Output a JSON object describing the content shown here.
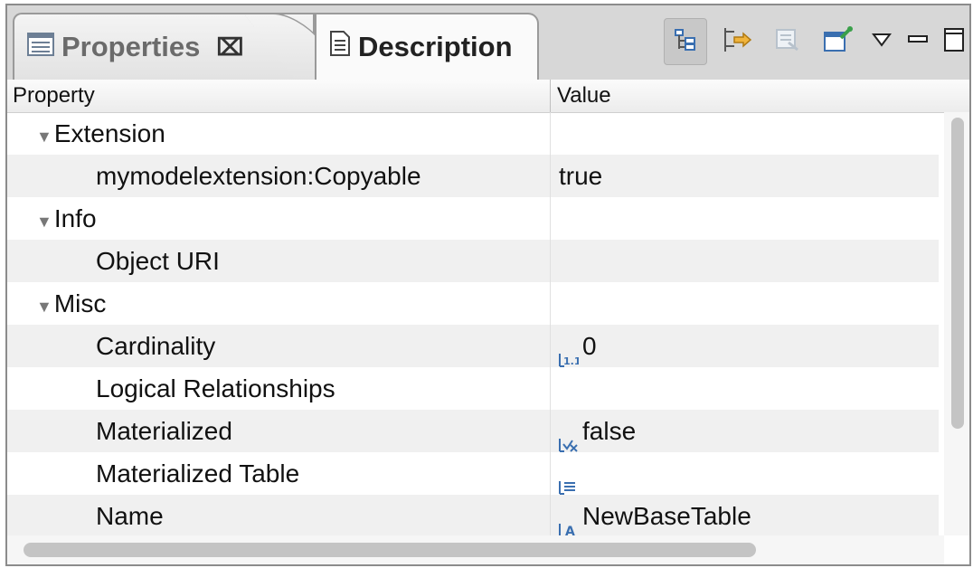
{
  "tabs": [
    {
      "label": "Properties",
      "close": "⌧",
      "icon": "properties-icon"
    },
    {
      "label": "Description",
      "icon": "document-icon"
    }
  ],
  "toolbar": {
    "buttons": [
      "categories-icon",
      "advanced-filter-icon",
      "restore-default-icon",
      "pin-icon"
    ],
    "view_menu": "view-menu-icon",
    "minimize": "minimize-icon",
    "maximize": "maximize-icon"
  },
  "header": {
    "property": "Property",
    "value": "Value"
  },
  "rows": [
    {
      "property": "Extension",
      "value": "",
      "type": "category",
      "expanded": true
    },
    {
      "property": "mymodelextension:Copyable",
      "value": "true",
      "type": "item"
    },
    {
      "property": "Info",
      "value": "",
      "type": "category",
      "expanded": true
    },
    {
      "property": "Object URI",
      "value": "",
      "type": "item"
    },
    {
      "property": "Misc",
      "value": "",
      "type": "category",
      "expanded": true
    },
    {
      "property": "Cardinality",
      "value": "0",
      "type": "item",
      "icon": "integer-icon"
    },
    {
      "property": "Logical Relationships",
      "value": "",
      "type": "item"
    },
    {
      "property": "Materialized",
      "value": "false",
      "type": "item",
      "icon": "boolean-icon"
    },
    {
      "property": "Materialized Table",
      "value": "",
      "type": "item",
      "icon": "reference-icon"
    },
    {
      "property": "Name",
      "value": "NewBaseTable",
      "type": "item",
      "icon": "string-icon"
    }
  ],
  "colors": {
    "tabbar": "#d7d7d7",
    "alt_row": "#f0f0f0",
    "icon_blue": "#3a6fb0",
    "pin_green": "#3aa04a"
  }
}
